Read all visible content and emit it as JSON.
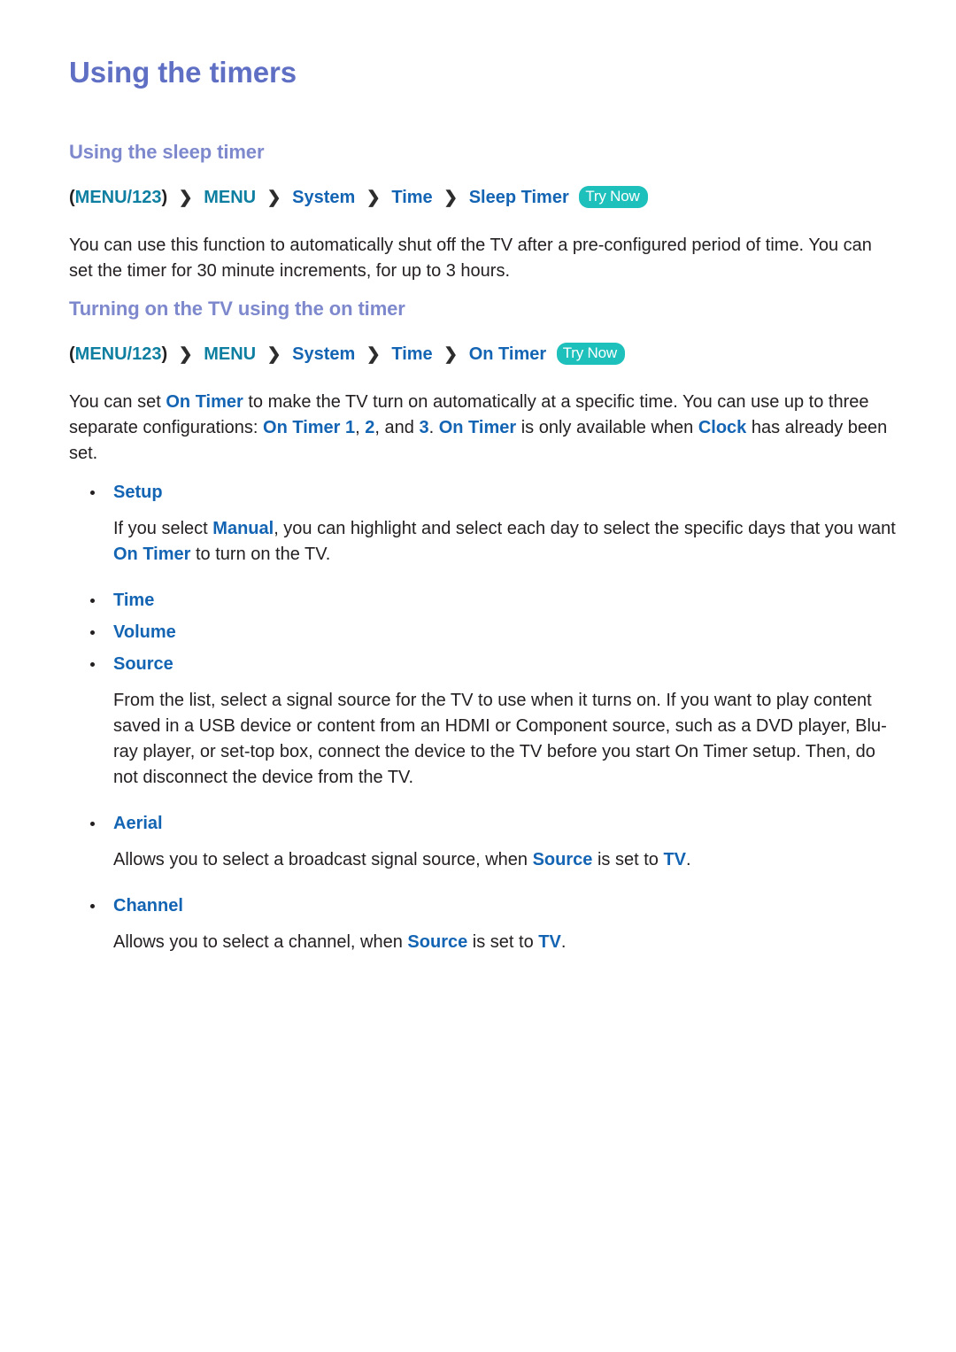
{
  "page": {
    "title": "Using the timers"
  },
  "sections": [
    {
      "heading": "Using the sleep timer",
      "breadcrumb": {
        "menu_123": "(MENU/123)",
        "open_paren": "(",
        "close_paren": ")",
        "menu_123_inner": "MENU/123",
        "separator": "❯",
        "items": [
          "MENU",
          "System",
          "Time",
          "Sleep Timer"
        ],
        "try_now": "Try Now"
      },
      "paragraph": "You can use this function to automatically shut off the TV after a pre-configured period of time. You can set the timer for 30 minute increments, for up to 3 hours."
    },
    {
      "heading": "Turning on the TV using the on timer",
      "breadcrumb": {
        "open_paren": "(",
        "close_paren": ")",
        "menu_123_inner": "MENU/123",
        "separator": "❯",
        "items": [
          "MENU",
          "System",
          "Time",
          "On Timer"
        ],
        "try_now": "Try Now"
      },
      "intro": {
        "t1": "You can set ",
        "k1": "On Timer",
        "t2": " to make the TV turn on automatically at a specific time. You can use up to three separate configurations: ",
        "k2": "On Timer 1",
        "t3": ", ",
        "k3": "2",
        "t4": ", and ",
        "k4": "3",
        "t5": ". ",
        "k5": "On Timer",
        "t6": " is only available when ",
        "k6": "Clock",
        "t7": " has already been set."
      }
    }
  ],
  "options": {
    "setup": {
      "label": "Setup",
      "desc": {
        "t1": "If you select ",
        "k1": "Manual",
        "t2": ", you can highlight and select each day to select the specific days that you want ",
        "k2": "On Timer",
        "t3": " to turn on the TV."
      }
    },
    "time": {
      "label": "Time"
    },
    "volume": {
      "label": "Volume"
    },
    "source": {
      "label": "Source",
      "desc": "From the list, select a signal source for the TV to use when it turns on. If you want to play content saved in a USB device or content from an HDMI or Component source, such as a DVD player, Blu-ray player, or set-top box, connect the device to the TV before you start On Timer setup. Then, do not disconnect the device from the TV."
    },
    "aerial": {
      "label": "Aerial",
      "desc": {
        "t1": "Allows you to select a broadcast signal source, when ",
        "k1": "Source",
        "t2": " is set to ",
        "k2": "TV",
        "t3": "."
      }
    },
    "channel": {
      "label": "Channel",
      "desc": {
        "t1": "Allows you to select a channel, when ",
        "k1": "Source",
        "t2": " is set to ",
        "k2": "TV",
        "t3": "."
      }
    }
  },
  "colors": {
    "page_title": "#5f6fc4",
    "section_title": "#7d88cd",
    "keyword_blue": "#1464b4",
    "menu_teal": "#0e7fa1",
    "try_now_badge": "#1ec0bc",
    "body_text": "#231f20",
    "background": "#ffffff"
  }
}
